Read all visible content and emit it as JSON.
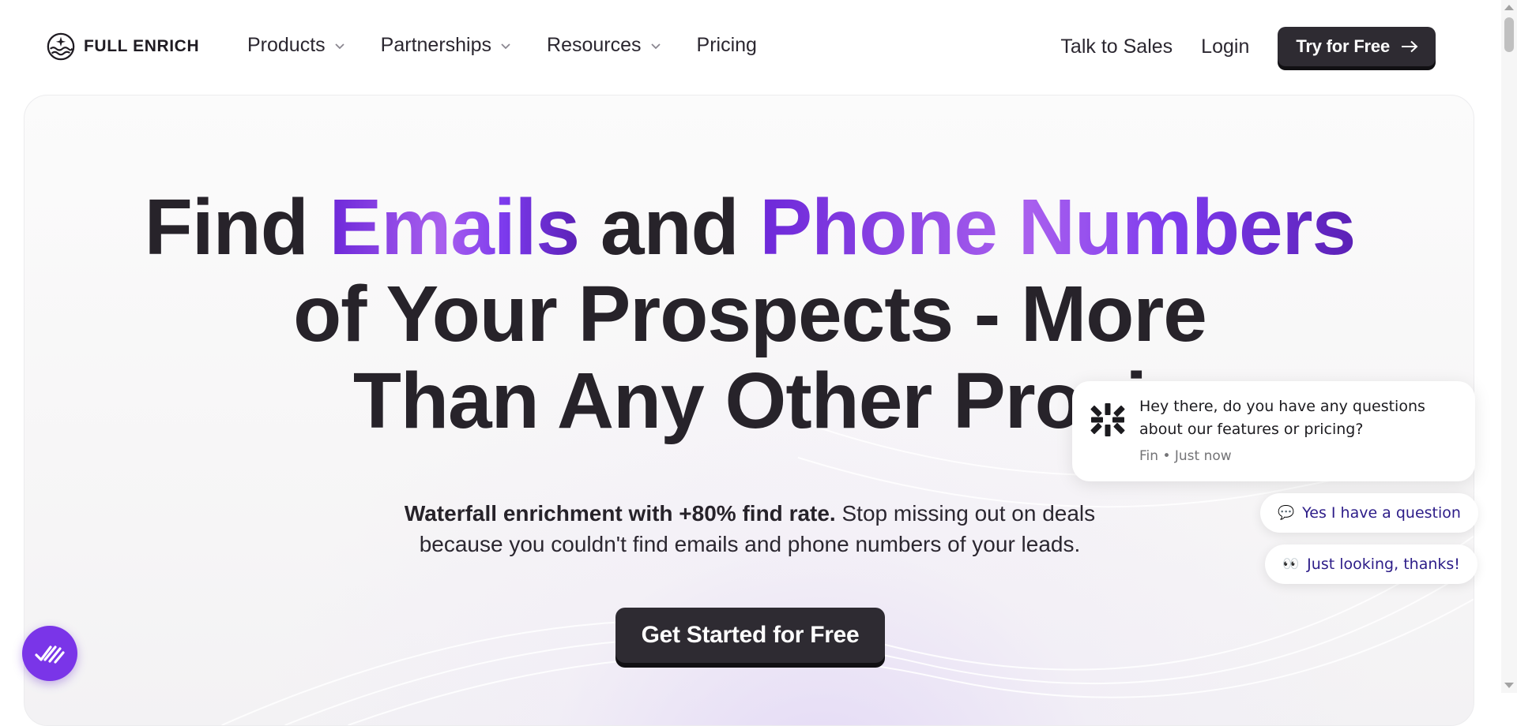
{
  "brand": {
    "name": "FULL ENRICH",
    "logo_icon": "circle-wave-star-icon"
  },
  "nav": {
    "items": [
      {
        "label": "Products",
        "has_dropdown": true
      },
      {
        "label": "Partnerships",
        "has_dropdown": true
      },
      {
        "label": "Resources",
        "has_dropdown": true
      },
      {
        "label": "Pricing",
        "has_dropdown": false
      }
    ],
    "talk_to_sales": "Talk to Sales",
    "login": "Login",
    "try_free": "Try for Free"
  },
  "hero": {
    "headline": {
      "w1": "Find ",
      "hl1": "Emails",
      "w2": " and ",
      "hl2": "Phone Numbers",
      "line2": "of Your Prospects - More",
      "line3": "Than Any Other Provi"
    },
    "sub_bold": "Waterfall enrichment with +80% find rate.",
    "sub_rest": " Stop missing out on deals",
    "sub_line2": "because you couldn't find emails and phone numbers of your leads.",
    "cta": "Get Started for Free"
  },
  "chat": {
    "message": "Hey there, do you have any questions about our features or pricing?",
    "meta": "Fin • Just now",
    "replies": [
      {
        "emoji": "💬",
        "label": "Yes I have a question"
      },
      {
        "emoji": "👀",
        "label": "Just looking, thanks!"
      }
    ]
  },
  "launcher": {
    "icon": "double-check-icon"
  },
  "colors": {
    "accent_purple": "#7c3aed",
    "button_dark": "#2e2b32",
    "chat_reply_text": "#2c1c88",
    "launcher_purple": "#7a35e8"
  }
}
